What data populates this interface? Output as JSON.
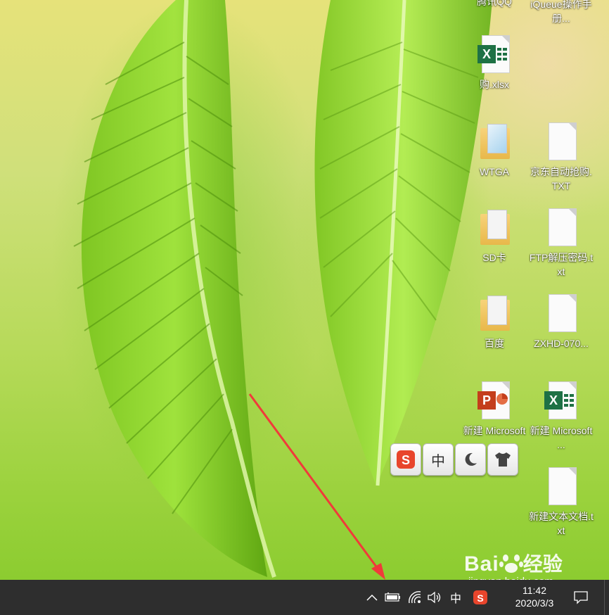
{
  "desktop": {
    "icons_top_cut": [
      {
        "label": "腾讯QQ"
      },
      {
        "label": "iQueue操作手册..."
      }
    ],
    "icons": [
      {
        "label": "购.xlsx",
        "type": "excel"
      },
      {
        "label": "WTGA",
        "type": "folder"
      },
      {
        "label": "京东自动抢购.TXT",
        "type": "text"
      },
      {
        "label": "SD卡",
        "type": "folder"
      },
      {
        "label": "FTP解压密码.txt",
        "type": "text"
      },
      {
        "label": "百度",
        "type": "folder"
      },
      {
        "label": "ZXHD-070...",
        "type": "text"
      },
      {
        "label": "新建 Microsoft ...",
        "type": "powerpoint"
      },
      {
        "label": "新建 Microsoft ...",
        "type": "excel"
      },
      {
        "label": "新建文本文档.txt",
        "type": "text"
      }
    ]
  },
  "ime_toolbar": {
    "buttons": [
      {
        "name": "sogou-logo-icon",
        "text": "S"
      },
      {
        "name": "chinese-mode",
        "text": "中"
      },
      {
        "name": "moon-icon",
        "text": ""
      },
      {
        "name": "shirt-skin-icon",
        "text": ""
      }
    ]
  },
  "taskbar": {
    "tray_ime_label": "中",
    "time": "11:42",
    "date": "2020/3/3",
    "icons": [
      "chevron-up-icon",
      "battery-icon",
      "wifi-icon",
      "volume-icon",
      "sogou-tray-icon",
      "notification-icon"
    ]
  },
  "watermark": {
    "brand": "Bai",
    "brand2": "经验",
    "url": "jingyan.baidu.com"
  },
  "colors": {
    "taskbar": "#2e2e2e",
    "excel_green": "#1e7145",
    "powerpoint_red": "#c43e1c",
    "sogou_red": "#e8452c",
    "arrow_red": "#f03a3a"
  }
}
